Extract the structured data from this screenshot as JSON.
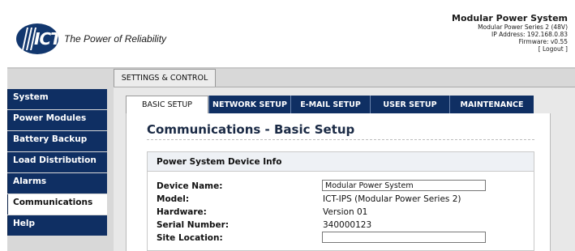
{
  "header": {
    "logo_text": "ICT",
    "tagline": "The Power of Reliability",
    "system_title": "Modular Power System",
    "system_series": "Modular Power Series 2 (48V)",
    "ip_address": "IP Address: 192.168.0.83",
    "firmware": "Firmware: v0.55",
    "logout": "[ Logout ]"
  },
  "main_tab": {
    "label": "SETTINGS & CONTROL"
  },
  "subtabs": [
    {
      "label": "BASIC SETUP",
      "active": true
    },
    {
      "label": "NETWORK SETUP",
      "active": false
    },
    {
      "label": "E-MAIL SETUP",
      "active": false
    },
    {
      "label": "USER SETUP",
      "active": false
    },
    {
      "label": "MAINTENANCE",
      "active": false
    }
  ],
  "sidebar": {
    "items": [
      {
        "label": "System",
        "active": false
      },
      {
        "label": "Power Modules",
        "active": false
      },
      {
        "label": "Battery Backup",
        "active": false
      },
      {
        "label": "Load Distribution",
        "active": false
      },
      {
        "label": "Alarms",
        "active": false
      },
      {
        "label": "Communications",
        "active": true
      },
      {
        "label": "Help",
        "active": false
      }
    ]
  },
  "page": {
    "title": "Communications - Basic Setup",
    "section_title": "Power System Device Info",
    "fields": {
      "device_name": {
        "label": "Device Name:",
        "value": "Modular Power System"
      },
      "model": {
        "label": "Model:",
        "value": "ICT-IPS (Modular Power Series 2)"
      },
      "hardware": {
        "label": "Hardware:",
        "value": "Version 01"
      },
      "serial": {
        "label": "Serial Number:",
        "value": "340000123"
      },
      "site_location": {
        "label": "Site Location:",
        "value": ""
      }
    }
  },
  "colors": {
    "nav_blue": "#0f2f63",
    "content_gray": "#d8d8d8",
    "section_head_bg": "#eef1f5"
  }
}
